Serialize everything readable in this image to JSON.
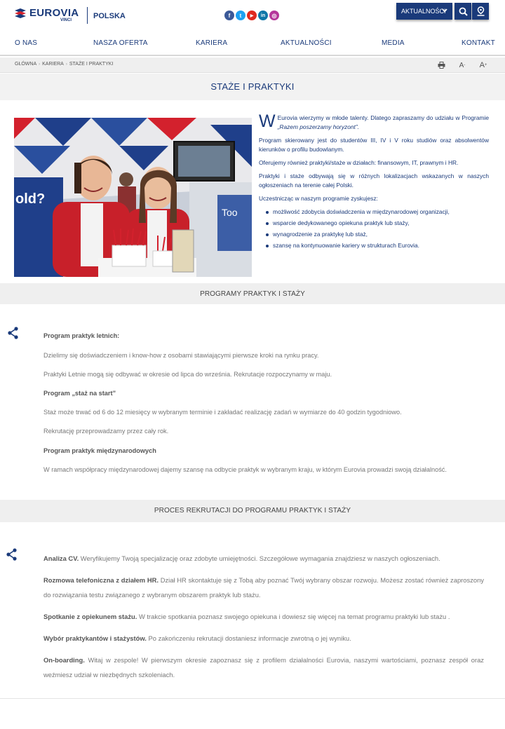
{
  "header": {
    "brand": "EUROVIA",
    "brand_sub": "VINCI",
    "country": "POLSKA",
    "news_button": "AKTUALNOŚCI",
    "socials": [
      {
        "name": "facebook-icon",
        "glyph": "f",
        "color": "#3b5998"
      },
      {
        "name": "twitter-icon",
        "glyph": "t",
        "color": "#1da1f2"
      },
      {
        "name": "youtube-icon",
        "glyph": "▶",
        "color": "#e02a20"
      },
      {
        "name": "linkedin-icon",
        "glyph": "in",
        "color": "#0e76a8"
      },
      {
        "name": "instagram-icon",
        "glyph": "◎",
        "color": "#b5369a"
      }
    ]
  },
  "nav": {
    "items": [
      "O NAS",
      "NASZA OFERTA",
      "KARIERA",
      "AKTUALNOŚCI",
      "MEDIA",
      "KONTAKT"
    ]
  },
  "breadcrumb": {
    "items": [
      "GŁÓWNA",
      "KARIERA",
      "STAŻE I PRAKTYKI"
    ]
  },
  "page": {
    "title": "STAŻE I PRAKTYKI"
  },
  "intro": {
    "dropcap": "W",
    "p1_rest": "Eurovia wierzymy w młode talenty. Dlatego zapraszamy do udziału w Programie ",
    "p1_em": "„Razem poszerzamy horyzont”.",
    "p2": "Program skierowany jest do studentów III, IV i V roku studiów oraz absolwentów kierunków o profilu budowlanym.",
    "p3": "Oferujemy również praktyki/staże w działach: finansowym, IT, prawnym i HR.",
    "p4": "Praktyki i staże odbywają się w różnych lokalizacjach wskazanych w naszych ogłoszeniach na terenie całej Polski.",
    "p5": "Uczestnicząc w naszym programie zyskujesz:",
    "bullets": [
      "możliwość zdobycia doświadczenia w międzynarodowej organizacji,",
      "wsparcie dedykowanego opiekuna praktyk lub staży,",
      "wynagrodzenie za praktykę lub staż,",
      "szansę na kontynuowanie kariery  w strukturach Eurovia."
    ]
  },
  "section1": {
    "title": "PROGRAMY PRAKTYK I STAŻY",
    "h1": "Program praktyk letnich:",
    "t1": "Dzielimy się doświadczeniem i know-how z osobami stawiającymi pierwsze kroki na rynku pracy.",
    "t2": "Praktyki Letnie mogą się odbywać w okresie od lipca do września. Rekrutacje rozpoczynamy w maju.",
    "h2": "Program „staż na start”",
    "t3": "Staż może trwać od 6 do 12 miesięcy w wybranym terminie i zakładać realizację zadań w wymiarze do 40 godzin tygodniowo.",
    "t4": "Rekrutację przeprowadzamy przez cały rok.",
    "h3": "Program praktyk międzynarodowych",
    "t5": "W ramach współpracy międzynarodowej dajemy szansę na odbycie praktyk w wybranym kraju, w którym Eurovia prowadzi swoją działalność."
  },
  "section2": {
    "title": "PROCES REKRUTACJI DO PROGRAMU PRAKTYK I STAŻY",
    "steps": [
      {
        "lead": "Analiza CV.",
        "text": " Weryfikujemy Twoją specjalizację oraz zdobyte umiejętności. Szczegółowe wymagania znajdziesz w naszych ogłoszeniach."
      },
      {
        "lead": "Rozmowa telefoniczna z działem HR.",
        "text": " Dział HR skontaktuje się z Tobą aby poznać Twój wybrany obszar rozwoju. Możesz zostać również zaproszony do rozwiązania testu związanego z wybranym obszarem praktyk lub stażu."
      },
      {
        "lead": "Spotkanie z opiekunem stażu.",
        "text": "  W trakcie spotkania poznasz swojego opiekuna i dowiesz się więcej na temat programu praktyki lub stażu ."
      },
      {
        "lead": "Wybór praktykantów i stażystów.",
        "text": " Po zakończeniu rekrutacji dostaniesz informacje zwrotną o jej wyniku."
      },
      {
        "lead": "On-boarding.",
        "text": " Witaj w zespole! W pierwszym okresie zapoznasz się z profilem działalności Eurovia, naszymi wartościami, poznasz zespół oraz weźmiesz udział w niezbędnych szkoleniach."
      }
    ]
  },
  "colors": {
    "brand": "#1a3a7a",
    "accent_red": "#d3212d",
    "band": "#efefef"
  }
}
